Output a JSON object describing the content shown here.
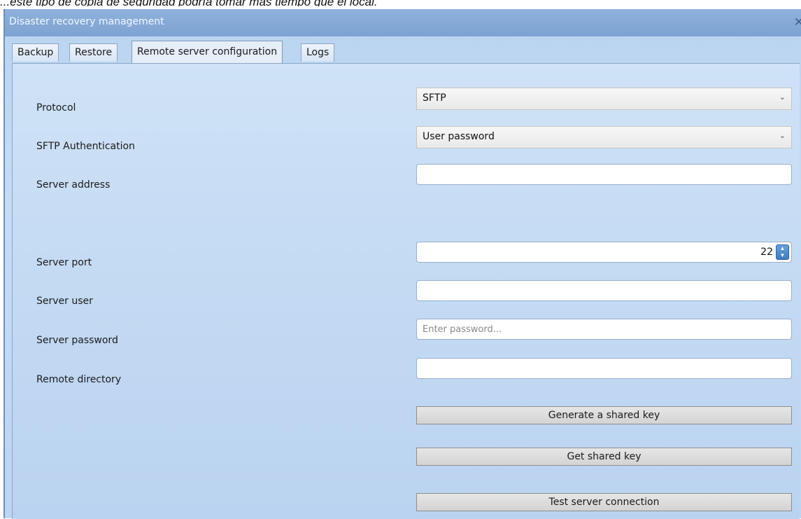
{
  "caption": "...este tipo de copia de seguridad podría tomar más tiempo que el local.",
  "window": {
    "title": "Disaster recovery management",
    "close_glyph": "✕"
  },
  "tabs": [
    {
      "label": "Backup"
    },
    {
      "label": "Restore"
    },
    {
      "label": "Remote server configuration",
      "active": true
    },
    {
      "label": "Logs"
    }
  ],
  "form": {
    "protocol": {
      "label": "Protocol",
      "value": "SFTP"
    },
    "sftp_auth": {
      "label": "SFTP Authentication",
      "value": "User password"
    },
    "server_address": {
      "label": "Server address",
      "value": ""
    },
    "server_port": {
      "label": "Server port",
      "value": "22"
    },
    "server_user": {
      "label": "Server user",
      "value": ""
    },
    "server_password": {
      "label": "Server password",
      "value": "",
      "placeholder": "Enter password..."
    },
    "remote_directory": {
      "label": "Remote directory",
      "value": ""
    }
  },
  "buttons": {
    "generate_key": "Generate a shared key",
    "get_key": "Get shared key",
    "test_connection": "Test server connection"
  },
  "icons": {
    "dropdown": "chevron-down-icon",
    "spinner": "spinner-arrows-icon",
    "close": "close-icon"
  },
  "colors": {
    "titlebar": "#7da3d2",
    "panel": "#c6dcf4",
    "spinner_button": "#3f7bc2"
  }
}
